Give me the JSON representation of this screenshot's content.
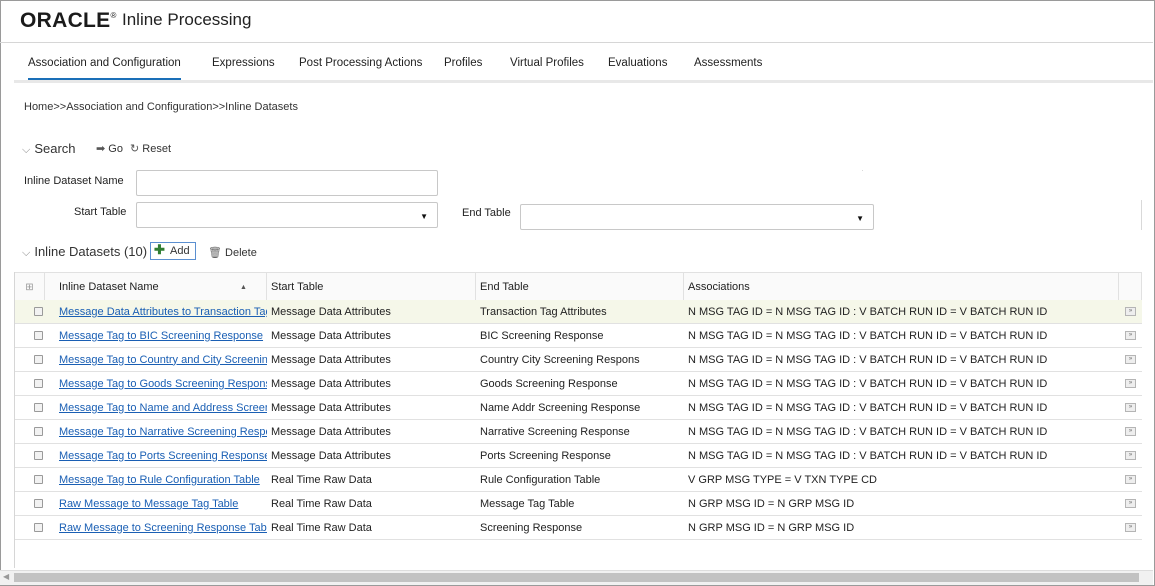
{
  "header": {
    "logo_text": "ORACLE",
    "logo_mark": "®",
    "app_title": "Inline Processing"
  },
  "tabs": [
    {
      "label": "Association and Configuration"
    },
    {
      "label": "Expressions"
    },
    {
      "label": "Post Processing Actions"
    },
    {
      "label": "Profiles"
    },
    {
      "label": "Virtual Profiles"
    },
    {
      "label": "Evaluations"
    },
    {
      "label": "Assessments"
    }
  ],
  "active_tab": "Association and Configuration",
  "breadcrumb": "Home>>Association and Configuration>>Inline Datasets",
  "search": {
    "title": "Search",
    "go_label": "Go",
    "reset_label": "Reset",
    "dataset_name_label": "Inline Dataset Name",
    "dataset_name_value": "",
    "start_table_label": "Start Table",
    "start_table_value": "",
    "end_table_label": "End Table",
    "end_table_value": ""
  },
  "datasets": {
    "title": "Inline Datasets",
    "count": "(10)",
    "add_label": "Add",
    "delete_label": "Delete",
    "columns": [
      "Inline Dataset Name",
      "Start Table",
      "End Table",
      "Associations"
    ],
    "sort_indicator": "▲",
    "rows": [
      {
        "name": "Message Data Attributes to Transaction Tag Attributes",
        "start": "Message Data Attributes",
        "end": "Transaction Tag Attributes",
        "assoc": "N MSG TAG ID = N MSG TAG ID : V BATCH RUN ID = V BATCH RUN ID"
      },
      {
        "name": "Message Tag to BIC Screening Response",
        "start": "Message Data Attributes",
        "end": "BIC Screening Response",
        "assoc": "N MSG TAG ID = N MSG TAG ID : V BATCH RUN ID = V BATCH RUN ID"
      },
      {
        "name": "Message Tag to Country and City Screening Response",
        "start": "Message Data Attributes",
        "end": "Country City Screening Respons",
        "assoc": "N MSG TAG ID = N MSG TAG ID : V BATCH RUN ID = V BATCH RUN ID"
      },
      {
        "name": "Message Tag to Goods Screening Response",
        "start": "Message Data Attributes",
        "end": "Goods Screening Response",
        "assoc": "N MSG TAG ID = N MSG TAG ID : V BATCH RUN ID = V BATCH RUN ID"
      },
      {
        "name": "Message Tag to Name and Address Screening Response",
        "start": "Message Data Attributes",
        "end": "Name Addr Screening Response",
        "assoc": "N MSG TAG ID = N MSG TAG ID : V BATCH RUN ID = V BATCH RUN ID"
      },
      {
        "name": "Message Tag to Narrative Screening Response",
        "start": "Message Data Attributes",
        "end": "Narrative Screening Response",
        "assoc": "N MSG TAG ID = N MSG TAG ID : V BATCH RUN ID = V BATCH RUN ID"
      },
      {
        "name": "Message Tag to Ports Screening Response",
        "start": "Message Data Attributes",
        "end": "Ports Screening Response",
        "assoc": "N MSG TAG ID = N MSG TAG ID : V BATCH RUN ID = V BATCH RUN ID"
      },
      {
        "name": "Message Tag to Rule Configuration Table",
        "start": "Real Time Raw Data",
        "end": "Rule Configuration Table",
        "assoc": "V GRP MSG TYPE = V TXN TYPE CD"
      },
      {
        "name": "Raw Message to Message Tag Table",
        "start": "Real Time Raw Data",
        "end": "Message Tag Table",
        "assoc": "N GRP MSG ID = N GRP MSG ID"
      },
      {
        "name": "Raw Message to Screening Response Table",
        "start": "Real Time Raw Data",
        "end": "Screening Response",
        "assoc": "N GRP MSG ID = N GRP MSG ID"
      }
    ]
  },
  "colors": {
    "link": "#1a5fb4",
    "active_tab": "#1a6fb8",
    "selected_row": "#f5f7e9"
  }
}
